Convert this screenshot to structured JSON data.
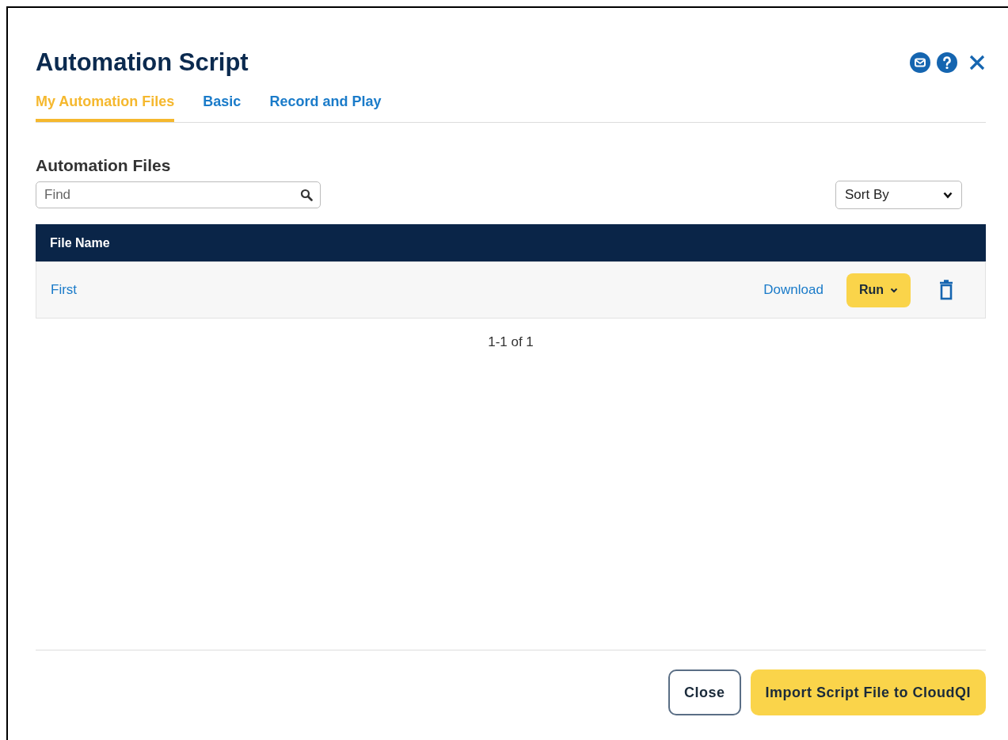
{
  "dialog": {
    "title": "Automation Script"
  },
  "tabs": [
    {
      "label": "My Automation Files",
      "selected": true
    },
    {
      "label": "Basic",
      "selected": false
    },
    {
      "label": "Record and Play",
      "selected": false
    }
  ],
  "section": {
    "heading": "Automation Files",
    "search": {
      "placeholder": "Find"
    },
    "sort": {
      "value": "Sort By"
    }
  },
  "table": {
    "columns": [
      "File Name"
    ],
    "rows": [
      {
        "file_name": "First",
        "download": "Download",
        "run": "Run"
      }
    ]
  },
  "pagination": "1-1 of 1",
  "buttons": [
    {
      "label": "Close",
      "kind": "secondary"
    },
    {
      "label": "Import Script File to CloudQI",
      "kind": "primary"
    }
  ]
}
